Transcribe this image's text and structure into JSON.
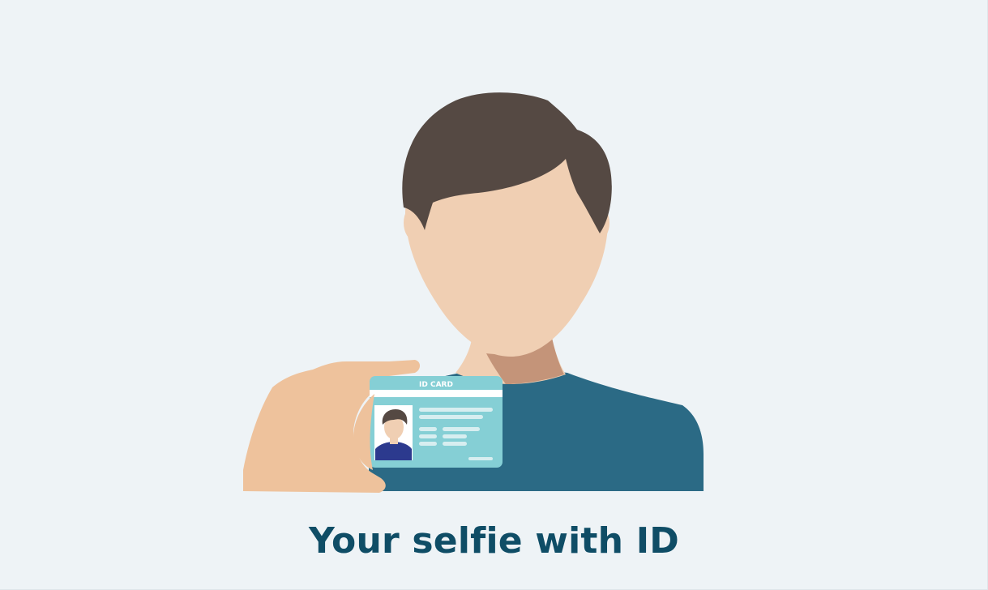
{
  "caption": "Your selfie with ID",
  "id_card": {
    "title": "ID CARD"
  },
  "colors": {
    "background": "#eef3f6",
    "hair": "#554943",
    "skin": "#f0cfb3",
    "neck_shadow": "#c49479",
    "shirt": "#2b6a85",
    "hand": "#eec29c",
    "card": "#85cfd5",
    "card_photo_shirt": "#2c3a8e",
    "caption_text": "#0f4d66"
  },
  "icons": {
    "person": "person-holding-id-card-illustration",
    "card_photo": "portrait-photo-icon"
  }
}
